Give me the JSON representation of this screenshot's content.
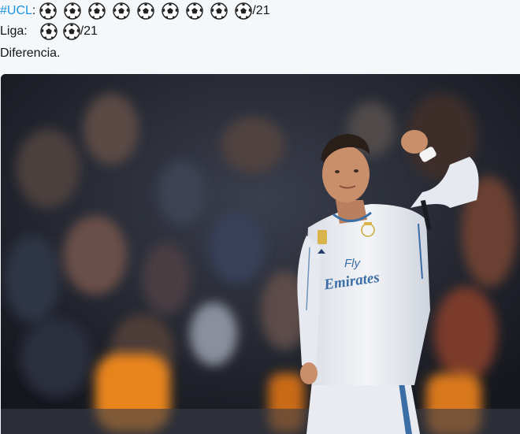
{
  "tweet": {
    "line1": {
      "hashtag": "#UCL",
      "colon": ":",
      "ball_count": 9,
      "total": "/21"
    },
    "line2": {
      "label": "Liga:",
      "ball_count": 2,
      "total": "/21"
    },
    "line3": "Diferencia.",
    "icon": "soccer-ball-icon"
  },
  "media": {
    "jersey_text_top": "Fly",
    "jersey_text_bottom": "Emirates",
    "colors": {
      "crowd": "#20242f",
      "jersey": "#eef0f4",
      "skin": "#c98f6b",
      "hair": "#2a1f18",
      "accent_blue": "#3a6ea5",
      "steward_orange": "#e8841f"
    }
  }
}
